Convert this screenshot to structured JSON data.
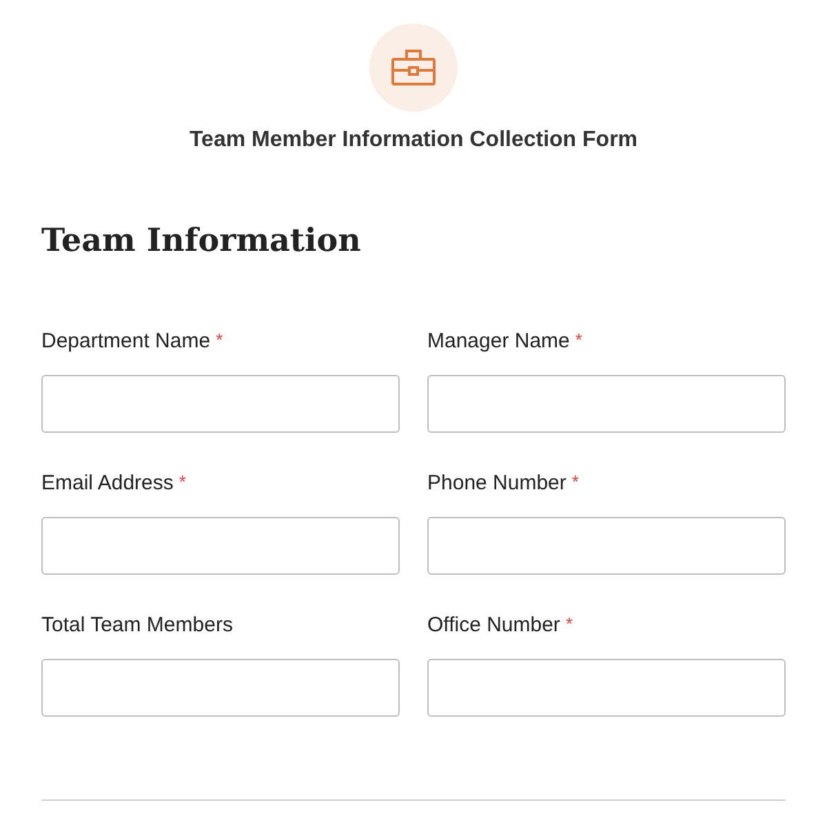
{
  "form_title": "Team Member Information Collection Form",
  "section": {
    "title": "Team Information"
  },
  "required_mark": "*",
  "fields": [
    {
      "label": "Department Name",
      "required": true
    },
    {
      "label": "Manager Name",
      "required": true
    },
    {
      "label": "Email Address",
      "required": true
    },
    {
      "label": "Phone Number",
      "required": true
    },
    {
      "label": "Total Team Members",
      "required": false
    },
    {
      "label": "Office Number",
      "required": true
    }
  ]
}
